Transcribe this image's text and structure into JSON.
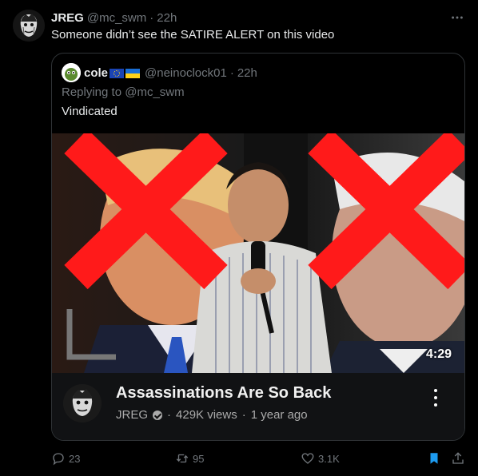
{
  "post": {
    "author_name": "JREG",
    "author_handle": "@mc_swm",
    "separator": "·",
    "time": "22h",
    "text": "Someone didn’t see the SATIRE ALERT on this video",
    "more_icon": "more-horizontal-icon"
  },
  "quote": {
    "author_name": "cole",
    "flags": [
      "eu-flag",
      "ukraine-flag"
    ],
    "author_handle": "@neinoclock01",
    "separator": "·",
    "time": "22h",
    "replying_prefix": "Replying to",
    "replying_to": "@mc_swm",
    "text": "Vindicated",
    "video": {
      "duration": "4:29",
      "title": "Assassinations Are So Back",
      "channel": "JREG",
      "views": "429K views",
      "age": "1 year ago",
      "dot": "·"
    }
  },
  "actions": {
    "replies": "23",
    "retweets": "95",
    "likes": "3.1K"
  },
  "colors": {
    "background": "#000000",
    "muted": "#71767b",
    "accent": "#1d9bf0",
    "red_x": "#ff0000"
  }
}
